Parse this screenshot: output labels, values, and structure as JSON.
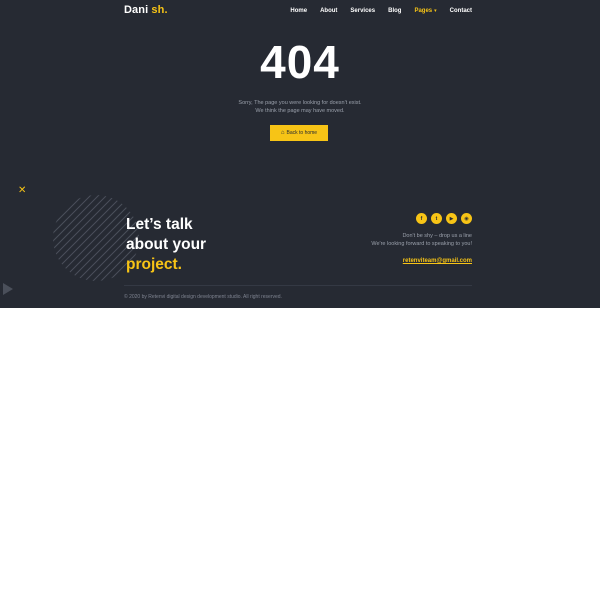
{
  "header": {
    "brand_main": "Dani",
    "brand_accent": "sh.",
    "nav": {
      "home": "Home",
      "about": "About",
      "services": "Services",
      "blog": "Blog",
      "pages": "Pages",
      "contact": "Contact"
    },
    "active_nav": "pages"
  },
  "error": {
    "code": "404",
    "line1": "Sorry, The page you were looking for doesn't exist.",
    "line2": "We think the page may have moved.",
    "button": "Back to home"
  },
  "cta": {
    "line1": "Let’s talk",
    "line2": "about your",
    "line3": "project."
  },
  "contact": {
    "social_icons": [
      "facebook-icon",
      "twitter-icon",
      "youtube-icon",
      "instagram-icon"
    ],
    "line1": "Don't be shy – drop us a line",
    "line2": "We're looking forward to speaking to you!",
    "email": "retenviteam@gmail.com"
  },
  "footer": {
    "copyright": "© 2020 by Retenvi digital design development studio. All right reserved."
  },
  "colors": {
    "background": "#262a33",
    "accent": "#f7c416",
    "text": "#ffffff",
    "muted": "#9aa0ab"
  }
}
